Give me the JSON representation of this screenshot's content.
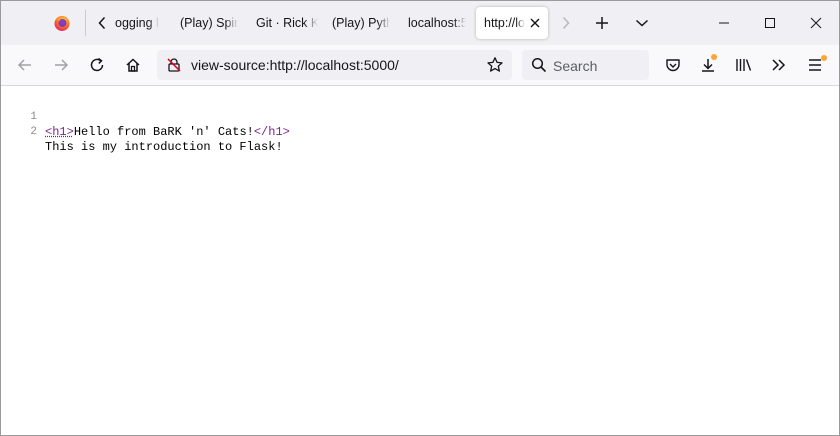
{
  "tabs": [
    {
      "title": "ogging l",
      "active": false
    },
    {
      "title": "(Play) Spir",
      "active": false
    },
    {
      "title": "Git · Rick K",
      "active": false
    },
    {
      "title": "(Play) Pyth",
      "active": false
    },
    {
      "title": "localhost:5",
      "active": false
    },
    {
      "title": "http://lo",
      "active": true
    }
  ],
  "address_bar": {
    "url": "view-source:http://localhost:5000/"
  },
  "search": {
    "placeholder": "Search"
  },
  "source": {
    "lines": [
      {
        "number": "1",
        "open_tag": "<h1>",
        "text": "Hello from BaRK 'n' Cats!",
        "close_tag": "</h1>"
      },
      {
        "number": "2",
        "text": "This is my introduction to Flask!"
      }
    ]
  },
  "icons": {
    "firefox": "firefox-logo-icon",
    "back": "arrow-left-icon",
    "forward": "arrow-right-icon",
    "reload": "reload-icon",
    "home": "home-icon",
    "tracking": "tracking-protection-icon",
    "bookmark": "star-icon",
    "pocket": "pocket-icon",
    "downloads": "download-icon",
    "library": "library-icon",
    "overflow": "chevron-double-right-icon",
    "menu": "hamburger-menu-icon"
  },
  "colors": {
    "accent_badge": "#ffa436",
    "tag_color": "#7a2a8a"
  }
}
